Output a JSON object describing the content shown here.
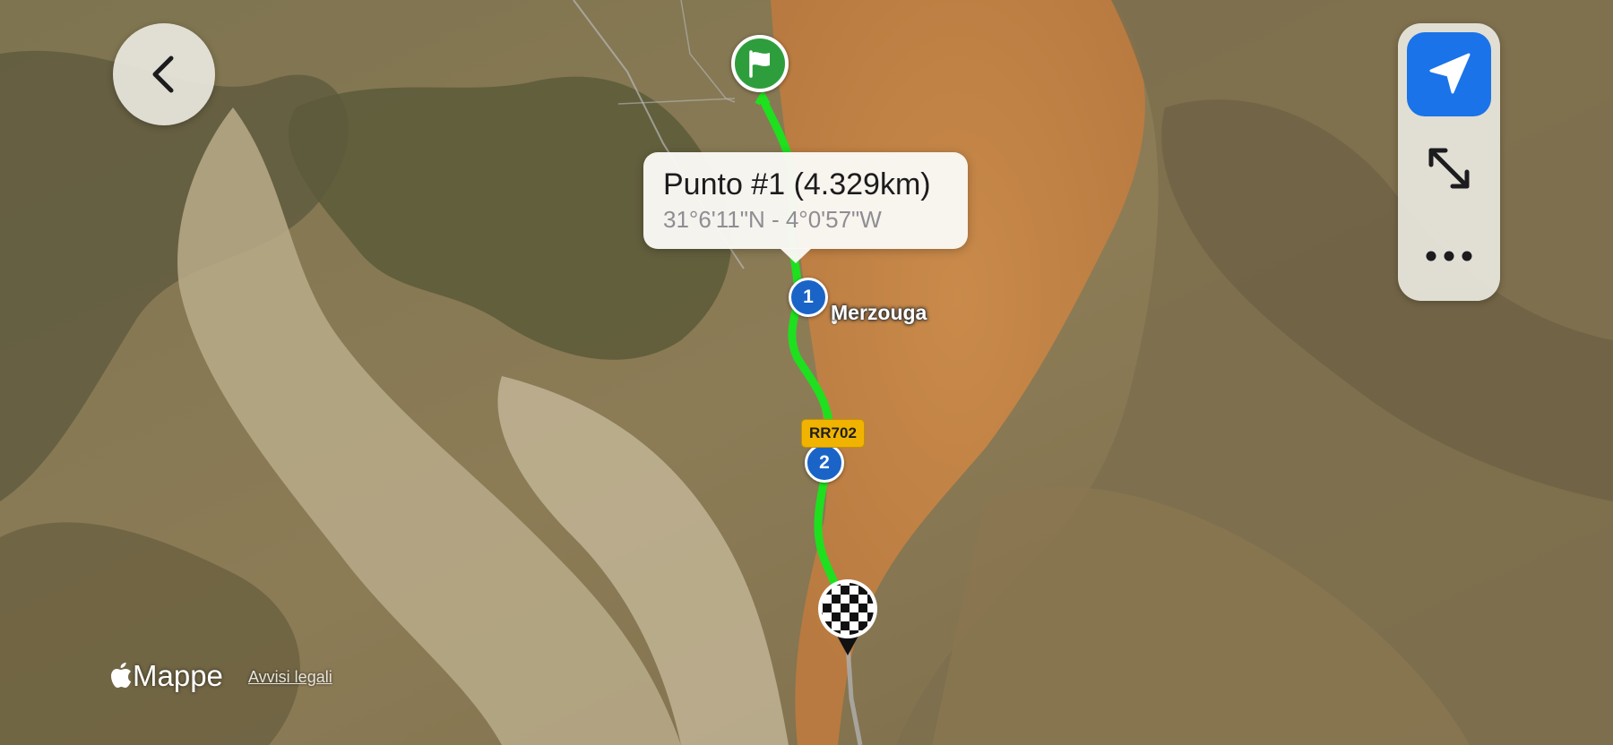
{
  "map": {
    "provider": "satellite",
    "route_color": "#1ee01e"
  },
  "back_button": {
    "icon": "chevron-left-icon"
  },
  "controls": {
    "locate_icon": "location-arrow-icon",
    "locate_color": "#1a73e8",
    "expand_icon": "expand-arrows-icon",
    "more_icon": "ellipsis-icon"
  },
  "callout": {
    "title": "Punto #1 (4.329km)",
    "coordinates": "31°6'11\"N - 4°0'57\"W"
  },
  "waypoints": [
    {
      "label": "1"
    },
    {
      "label": "2"
    }
  ],
  "start_marker": {
    "icon": "flag-icon",
    "color": "#2e9e3c"
  },
  "finish_marker": {
    "icon": "checkered-flag-icon"
  },
  "road_label": "RR702",
  "place_label": "Merzouga",
  "attribution": {
    "brand": "Mappe",
    "legal": "Avvisi legali"
  }
}
